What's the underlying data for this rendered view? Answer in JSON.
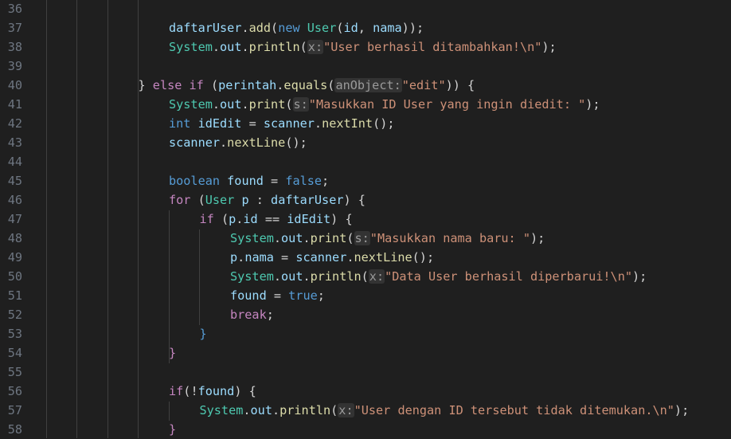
{
  "editor": {
    "lines": [
      {
        "num": "36",
        "indent": 0,
        "tokens": []
      },
      {
        "num": "37",
        "indent": 4,
        "tokens": [
          {
            "t": "daftarUser",
            "c": "var"
          },
          {
            "t": ".",
            "c": "plain"
          },
          {
            "t": "add",
            "c": "fn"
          },
          {
            "t": "(",
            "c": "plain"
          },
          {
            "t": "new ",
            "c": "kw"
          },
          {
            "t": "User",
            "c": "type"
          },
          {
            "t": "(",
            "c": "plain"
          },
          {
            "t": "id",
            "c": "var"
          },
          {
            "t": ", ",
            "c": "plain"
          },
          {
            "t": "nama",
            "c": "var"
          },
          {
            "t": "));",
            "c": "plain"
          }
        ]
      },
      {
        "num": "38",
        "indent": 4,
        "tokens": [
          {
            "t": "System",
            "c": "type"
          },
          {
            "t": ".",
            "c": "plain"
          },
          {
            "t": "out",
            "c": "var"
          },
          {
            "t": ".",
            "c": "plain"
          },
          {
            "t": "println",
            "c": "fn"
          },
          {
            "t": "(",
            "c": "plain"
          },
          {
            "t": "x:",
            "c": "hint"
          },
          {
            "t": "\"User berhasil ditambahkan!\\n\"",
            "c": "str"
          },
          {
            "t": ");",
            "c": "plain"
          }
        ]
      },
      {
        "num": "39",
        "indent": 0,
        "tokens": []
      },
      {
        "num": "40",
        "indent": 3,
        "tokens": [
          {
            "t": "} ",
            "c": "plain"
          },
          {
            "t": "else if ",
            "c": "ctl"
          },
          {
            "t": "(",
            "c": "plain"
          },
          {
            "t": "perintah",
            "c": "var"
          },
          {
            "t": ".",
            "c": "plain"
          },
          {
            "t": "equals",
            "c": "fn"
          },
          {
            "t": "(",
            "c": "plain"
          },
          {
            "t": "anObject:",
            "c": "hint"
          },
          {
            "t": "\"edit\"",
            "c": "str"
          },
          {
            "t": ")) {",
            "c": "plain"
          }
        ]
      },
      {
        "num": "41",
        "indent": 4,
        "tokens": [
          {
            "t": "System",
            "c": "type"
          },
          {
            "t": ".",
            "c": "plain"
          },
          {
            "t": "out",
            "c": "var"
          },
          {
            "t": ".",
            "c": "plain"
          },
          {
            "t": "print",
            "c": "fn"
          },
          {
            "t": "(",
            "c": "plain"
          },
          {
            "t": "s:",
            "c": "hint"
          },
          {
            "t": "\"Masukkan ID User yang ingin diedit: \"",
            "c": "str"
          },
          {
            "t": ");",
            "c": "plain"
          }
        ]
      },
      {
        "num": "42",
        "indent": 4,
        "tokens": [
          {
            "t": "int ",
            "c": "kw"
          },
          {
            "t": "idEdit",
            "c": "var"
          },
          {
            "t": " = ",
            "c": "plain"
          },
          {
            "t": "scanner",
            "c": "var"
          },
          {
            "t": ".",
            "c": "plain"
          },
          {
            "t": "nextInt",
            "c": "fn"
          },
          {
            "t": "();",
            "c": "plain"
          }
        ]
      },
      {
        "num": "43",
        "indent": 4,
        "tokens": [
          {
            "t": "scanner",
            "c": "var"
          },
          {
            "t": ".",
            "c": "plain"
          },
          {
            "t": "nextLine",
            "c": "fn"
          },
          {
            "t": "();",
            "c": "plain"
          }
        ]
      },
      {
        "num": "44",
        "indent": 0,
        "tokens": []
      },
      {
        "num": "45",
        "indent": 4,
        "tokens": [
          {
            "t": "boolean ",
            "c": "kw"
          },
          {
            "t": "found",
            "c": "var"
          },
          {
            "t": " = ",
            "c": "plain"
          },
          {
            "t": "false",
            "c": "kw"
          },
          {
            "t": ";",
            "c": "plain"
          }
        ]
      },
      {
        "num": "46",
        "indent": 4,
        "tokens": [
          {
            "t": "for ",
            "c": "ctl"
          },
          {
            "t": "(",
            "c": "plain"
          },
          {
            "t": "User ",
            "c": "type"
          },
          {
            "t": "p",
            "c": "var"
          },
          {
            "t": " : ",
            "c": "plain"
          },
          {
            "t": "daftarUser",
            "c": "var"
          },
          {
            "t": ") {",
            "c": "plain"
          }
        ]
      },
      {
        "num": "47",
        "indent": 5,
        "tokens": [
          {
            "t": "if ",
            "c": "ctl"
          },
          {
            "t": "(",
            "c": "plain"
          },
          {
            "t": "p",
            "c": "var"
          },
          {
            "t": ".",
            "c": "plain"
          },
          {
            "t": "id",
            "c": "var"
          },
          {
            "t": " == ",
            "c": "plain"
          },
          {
            "t": "idEdit",
            "c": "var"
          },
          {
            "t": ") {",
            "c": "plain"
          }
        ]
      },
      {
        "num": "48",
        "indent": 6,
        "tokens": [
          {
            "t": "System",
            "c": "type"
          },
          {
            "t": ".",
            "c": "plain"
          },
          {
            "t": "out",
            "c": "var"
          },
          {
            "t": ".",
            "c": "plain"
          },
          {
            "t": "print",
            "c": "fn"
          },
          {
            "t": "(",
            "c": "plain"
          },
          {
            "t": "s:",
            "c": "hint"
          },
          {
            "t": "\"Masukkan nama baru: \"",
            "c": "str"
          },
          {
            "t": ");",
            "c": "plain"
          }
        ]
      },
      {
        "num": "49",
        "indent": 6,
        "tokens": [
          {
            "t": "p",
            "c": "var"
          },
          {
            "t": ".",
            "c": "plain"
          },
          {
            "t": "nama",
            "c": "var"
          },
          {
            "t": " = ",
            "c": "plain"
          },
          {
            "t": "scanner",
            "c": "var"
          },
          {
            "t": ".",
            "c": "plain"
          },
          {
            "t": "nextLine",
            "c": "fn"
          },
          {
            "t": "();",
            "c": "plain"
          }
        ]
      },
      {
        "num": "50",
        "indent": 6,
        "tokens": [
          {
            "t": "System",
            "c": "type"
          },
          {
            "t": ".",
            "c": "plain"
          },
          {
            "t": "out",
            "c": "var"
          },
          {
            "t": ".",
            "c": "plain"
          },
          {
            "t": "println",
            "c": "fn"
          },
          {
            "t": "(",
            "c": "plain"
          },
          {
            "t": "x:",
            "c": "hint"
          },
          {
            "t": "\"Data User berhasil diperbarui!\\n\"",
            "c": "str"
          },
          {
            "t": ");",
            "c": "plain"
          }
        ]
      },
      {
        "num": "51",
        "indent": 6,
        "tokens": [
          {
            "t": "found",
            "c": "var"
          },
          {
            "t": " = ",
            "c": "plain"
          },
          {
            "t": "true",
            "c": "kw"
          },
          {
            "t": ";",
            "c": "plain"
          }
        ]
      },
      {
        "num": "52",
        "indent": 6,
        "tokens": [
          {
            "t": "break",
            "c": "ctl"
          },
          {
            "t": ";",
            "c": "plain"
          }
        ]
      },
      {
        "num": "53",
        "indent": 5,
        "tokens": [
          {
            "t": "}",
            "c": "kw"
          }
        ]
      },
      {
        "num": "54",
        "indent": 4,
        "tokens": [
          {
            "t": "}",
            "c": "ctl"
          }
        ]
      },
      {
        "num": "55",
        "indent": 0,
        "tokens": []
      },
      {
        "num": "56",
        "indent": 4,
        "tokens": [
          {
            "t": "if",
            "c": "ctl"
          },
          {
            "t": "(!",
            "c": "plain"
          },
          {
            "t": "found",
            "c": "var"
          },
          {
            "t": ") {",
            "c": "plain"
          }
        ]
      },
      {
        "num": "57",
        "indent": 5,
        "tokens": [
          {
            "t": "System",
            "c": "type"
          },
          {
            "t": ".",
            "c": "plain"
          },
          {
            "t": "out",
            "c": "var"
          },
          {
            "t": ".",
            "c": "plain"
          },
          {
            "t": "println",
            "c": "fn"
          },
          {
            "t": "(",
            "c": "plain"
          },
          {
            "t": "x:",
            "c": "hint"
          },
          {
            "t": "\"User dengan ID tersebut tidak ditemukan.\\n\"",
            "c": "str"
          },
          {
            "t": ");",
            "c": "plain"
          }
        ]
      },
      {
        "num": "58",
        "indent": 4,
        "tokens": [
          {
            "t": "}",
            "c": "ctl"
          }
        ]
      }
    ]
  }
}
